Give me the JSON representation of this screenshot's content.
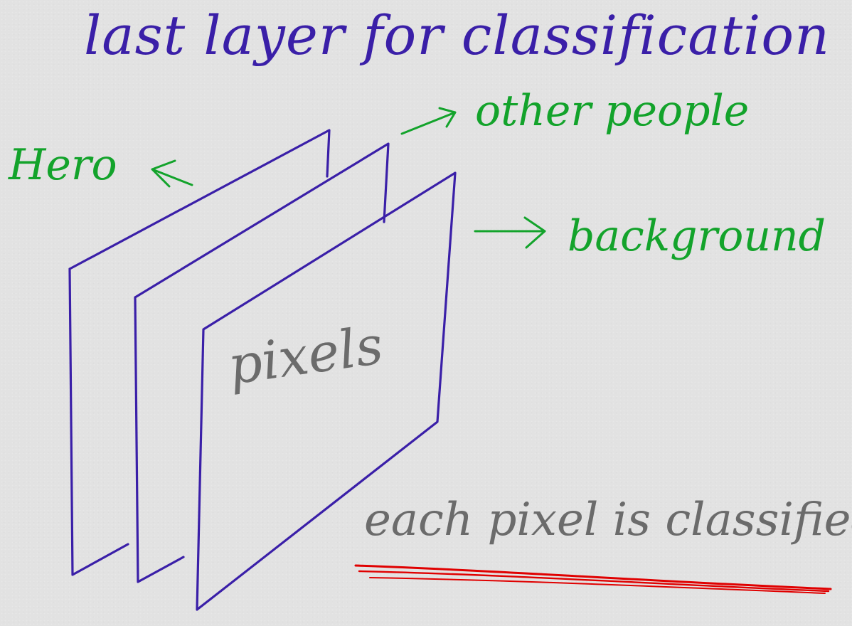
{
  "title": "last layer for classification",
  "labels": {
    "hero": "Hero",
    "other_people": "other people",
    "background": "background",
    "pixels": "pixels",
    "caption": "each pixel is classified"
  },
  "colors": {
    "background": "#e2e2e2",
    "title_ink": "#3a1fa8",
    "plane_ink": "#3a1fa8",
    "label_ink": "#13a32b",
    "gray_ink": "#6b6b6b",
    "underline_ink": "#e00000"
  }
}
